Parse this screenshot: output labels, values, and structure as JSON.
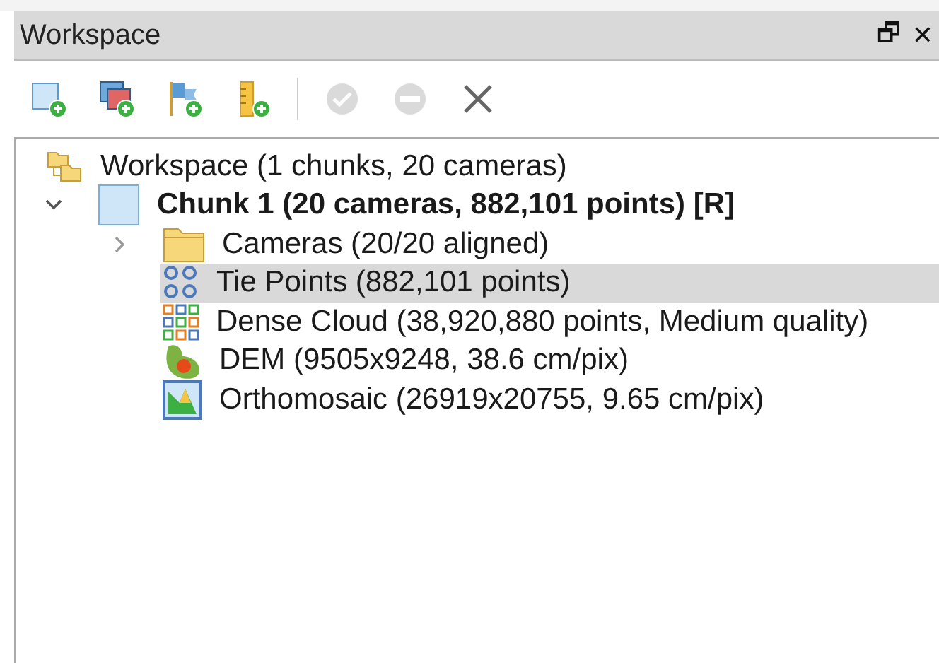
{
  "panel": {
    "title": "Workspace",
    "float_glyph": "🗗",
    "close_glyph": "✕"
  },
  "toolbar": [
    {
      "kind": "add-chunk",
      "disabled": false
    },
    {
      "kind": "add-photos",
      "disabled": false
    },
    {
      "kind": "add-markers",
      "disabled": false
    },
    {
      "kind": "add-scalebar",
      "disabled": false
    },
    {
      "kind": "separator"
    },
    {
      "kind": "enable",
      "disabled": true
    },
    {
      "kind": "disable",
      "disabled": true
    },
    {
      "kind": "remove",
      "disabled": false
    }
  ],
  "tree": [
    {
      "kind": "workspace",
      "label": "Workspace (1 chunks, 20 cameras)",
      "bold": false,
      "selected": false,
      "children": [
        {
          "kind": "chunk",
          "label": "Chunk 1 (20 cameras, 882,101 points) [R]",
          "bold": true,
          "selected": false,
          "expanded": true,
          "children": [
            {
              "kind": "folder",
              "label": "Cameras (20/20 aligned)",
              "bold": false,
              "selected": false,
              "expanded": false
            },
            {
              "kind": "tie-points",
              "label": "Tie Points (882,101 points)",
              "bold": false,
              "selected": true
            },
            {
              "kind": "dense-cloud",
              "label": "Dense Cloud (38,920,880 points, Medium quality)",
              "bold": false,
              "selected": false
            },
            {
              "kind": "dem",
              "label": "DEM (9505x9248, 38.6 cm/pix)",
              "bold": false,
              "selected": false
            },
            {
              "kind": "orthomosaic",
              "label": "Orthomosaic (26919x20755, 9.65 cm/pix)",
              "bold": false,
              "selected": false
            }
          ]
        }
      ]
    }
  ]
}
